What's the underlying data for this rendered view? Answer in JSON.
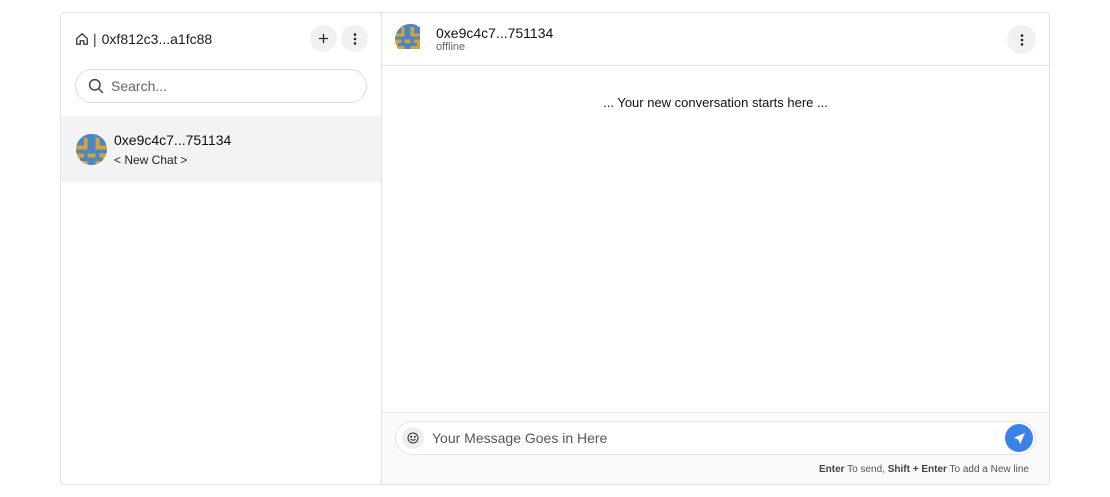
{
  "sidebar": {
    "account_address": "0xf812c3...a1fc88",
    "separator": "|",
    "search": {
      "placeholder": "Search..."
    },
    "chats": [
      {
        "name": "0xe9c4c7...751134",
        "preview": "< New Chat >"
      }
    ]
  },
  "conversation": {
    "contact_name": "0xe9c4c7...751134",
    "contact_status": "offline",
    "start_notice": "... Your new conversation starts here ..."
  },
  "composer": {
    "placeholder": "Your Message Goes in Here",
    "hint": {
      "key_send": "Enter",
      "text_send": " To send, ",
      "key_newline": "Shift + Enter",
      "text_newline": " To add a New line"
    }
  },
  "icons": {
    "home": "home-icon",
    "new_chat": "plus-icon",
    "menu": "kebab-menu-icon",
    "search": "search-icon",
    "emoji": "emoji-icon",
    "send": "send-icon"
  },
  "colors": {
    "accent": "#3b82e8",
    "avatar_primary": "#4a86c8",
    "avatar_secondary": "#d4a536",
    "selected_row": "#f3f3f3"
  }
}
